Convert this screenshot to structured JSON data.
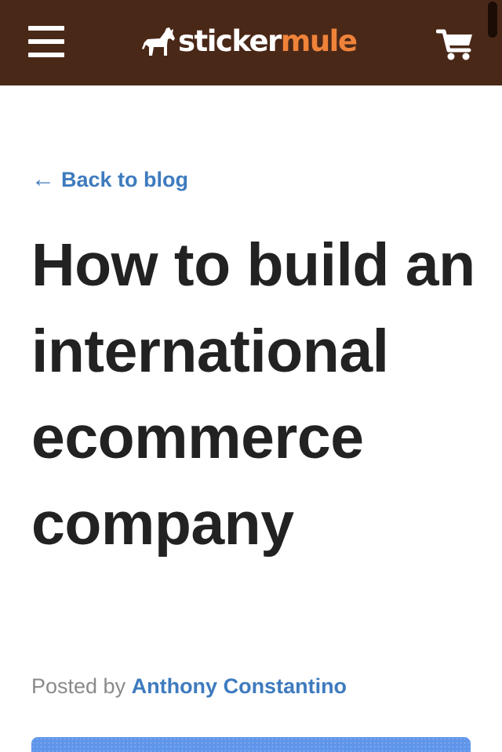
{
  "header": {
    "menu_icon": "hamburger-menu-icon",
    "logo": {
      "icon": "mule-icon",
      "word1": "sticker",
      "word2": "mule",
      "color1": "#ffffff",
      "color2": "#f0833a"
    },
    "cart_icon": "shopping-cart-icon",
    "background": "#4a2818"
  },
  "back_link": {
    "arrow": "←",
    "label": "Back to blog",
    "color": "#3e7bbe"
  },
  "article": {
    "title": "How to build an international ecommerce company",
    "byline_prefix": "Posted by",
    "author": "Anthony Constantino"
  },
  "hero_image": {
    "description_icon": "world-map-image",
    "color": "#5e95ea"
  }
}
